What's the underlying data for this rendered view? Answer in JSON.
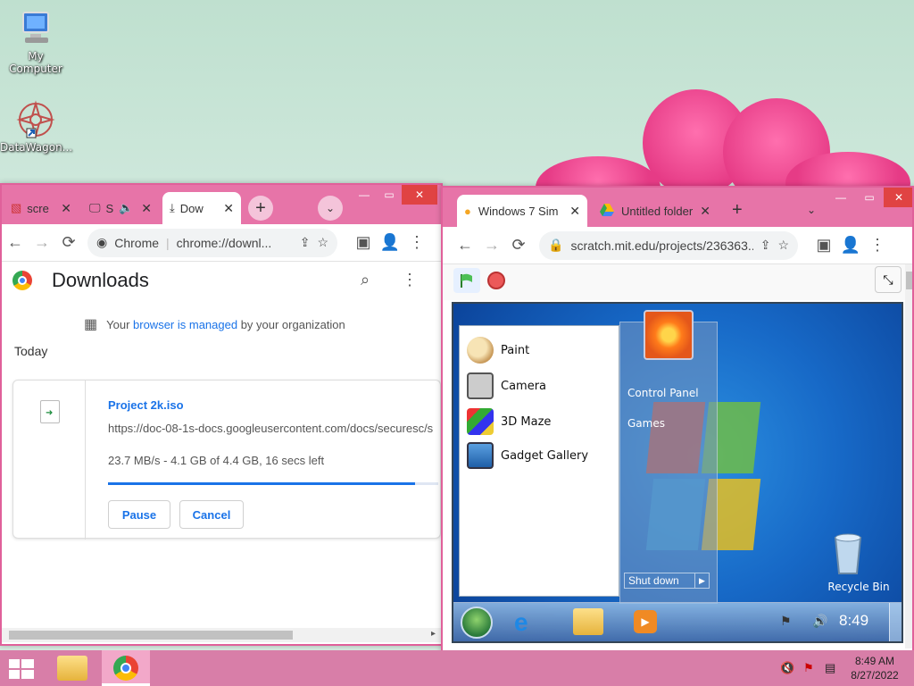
{
  "desktop": {
    "icons": [
      {
        "label": "My Computer"
      },
      {
        "label": "DataWagon..."
      }
    ]
  },
  "downloads_window": {
    "tabs": [
      {
        "label": "scre"
      },
      {
        "label": "S"
      },
      {
        "label": "Dow"
      }
    ],
    "omnibox": {
      "site_label": "Chrome",
      "url": "chrome://downl..."
    },
    "page_title": "Downloads",
    "managed_notice": {
      "prefix": "Your ",
      "link": "browser is managed",
      "suffix": " by your organization"
    },
    "section_label": "Today",
    "item": {
      "filename": "Project 2k.iso",
      "url": "https://doc-08-1s-docs.googleusercontent.com/docs/securesc/s",
      "status": "23.7 MB/s - 4.1 GB of 4.4 GB, 16 secs left",
      "progress": 0.93,
      "pause_label": "Pause",
      "cancel_label": "Cancel"
    }
  },
  "scratch_window": {
    "tabs": [
      {
        "label": "Windows 7 Sim"
      },
      {
        "label": "Untitled folder"
      }
    ],
    "omnibox": {
      "url": "scratch.mit.edu/projects/236363..."
    },
    "win7": {
      "start_menu_left": [
        {
          "label": "Paint"
        },
        {
          "label": "Camera"
        },
        {
          "label": "3D Maze"
        },
        {
          "label": "Gadget Gallery"
        }
      ],
      "start_menu_right": [
        {
          "label": "Control Panel"
        },
        {
          "label": "Games"
        }
      ],
      "shutdown_label": "Shut down",
      "recycle_bin_label": "Recycle Bin",
      "clock": "8:49"
    }
  },
  "taskbar": {
    "time": "8:49 AM",
    "date": "8/27/2022"
  },
  "colors": {
    "accent_pink": "#e774a8",
    "taskbar_pink": "#d87ea8",
    "link_blue": "#1a73e8"
  }
}
